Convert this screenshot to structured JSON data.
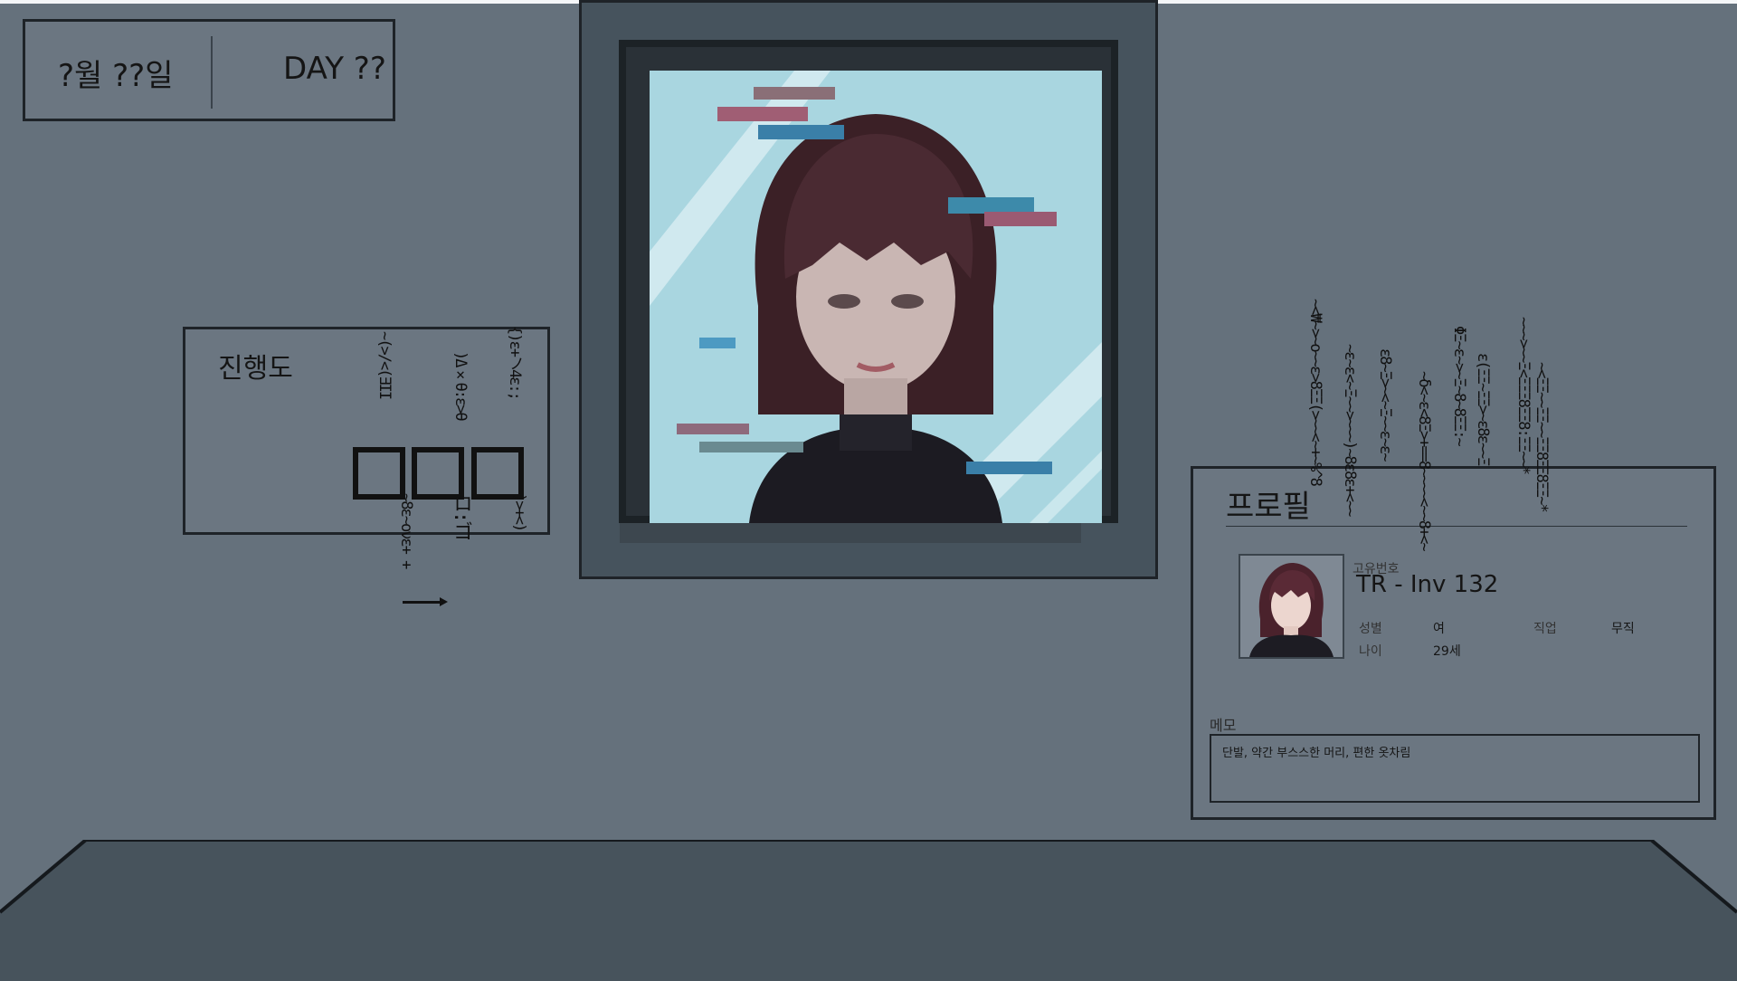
{
  "date": {
    "month_day": "?월 ??일",
    "day_counter": "DAY ??"
  },
  "progress": {
    "title": "진행도",
    "glitch_glyphs": "~(>/<(ƎII",
    "glitch_glyphs_2": ")Δ×θ:ε>θ",
    "glitch_glyphs_3": "{)ε+ノ4ε:;",
    "glitch_below_1": "~8ε~ονε+ +",
    "glitch_below_2": "ロ:ゴ",
    "glitch_below_3": ")>+<)"
  },
  "profile": {
    "title": "프로필",
    "id_label": "고유번호",
    "id_value": "TR - Inv 132",
    "gender_label": "성별",
    "gender_value": "여",
    "job_label": "직업",
    "job_value": "무직",
    "age_label": "나이",
    "age_value": "29세",
    "memo_label": "메모",
    "memo_text": "단발, 약간 부스스한 머리, 편한 옷차림"
  },
  "glitch_columns": [
    "~<₩~>~ο~~ε>8ΞΞ(>~~<~+~%^8",
    "~ε~ε<~Ξ~~>~~~)~8ε8ε+<~~",
    "ε8~Ξ>~<~Ξ~~ε~ε~",
    "~δ<~ε<8Ξ>+==8~~~~<~~8+<~",
    "ΦΞ~ε~>~Ξ~8~8ΞΞ:~",
    "ε(ΞΞ~ΞΞ>~ε8ε~~Ξ",
    "~~~>~~Ξ<ΞΞΞ8ΞΞ8:ΞΞ~~*",
    "~<ΞΞ~~ΞΞ~~ΞΞ8ΞΞ8ΞΞ~*"
  ],
  "colors": {
    "wall": "#65717c",
    "panel": "#6b7681",
    "frame": "#46535d",
    "floor": "#47535c",
    "sky": "#a9d6e0"
  }
}
